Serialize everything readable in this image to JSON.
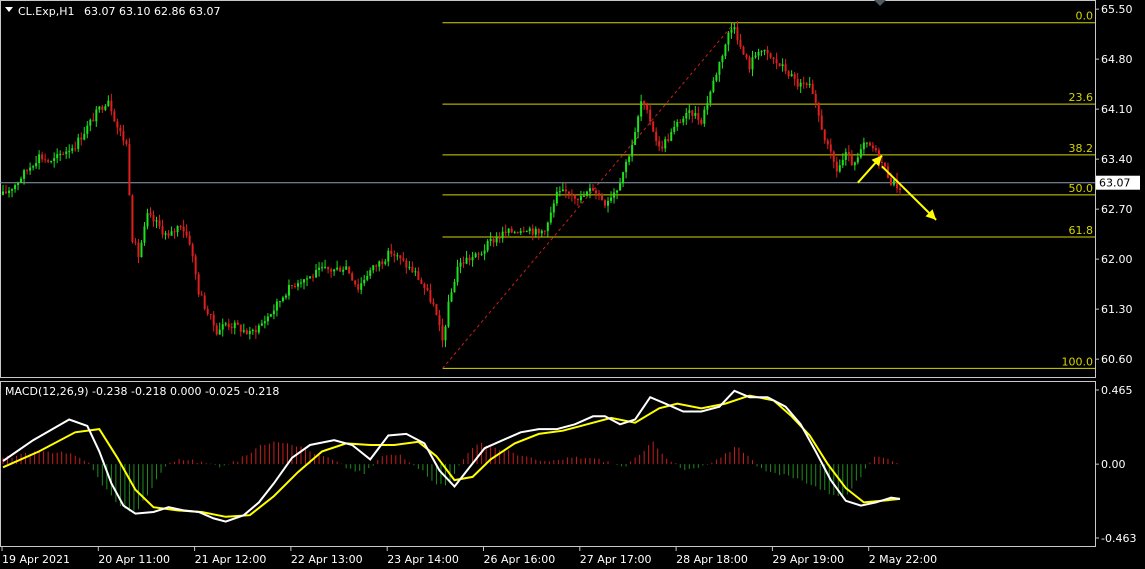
{
  "header": {
    "symbol": "CL.Exp,H1",
    "ohlc": "63.07 63.10 62.86 63.07"
  },
  "macd_header": "MACD(12,26,9) -0.238 -0.218 0.000 -0.025 -0.218",
  "colors": {
    "background": "#000000",
    "bull": "#1ee01e",
    "bear": "#e01e1e",
    "fib": "#d4d400",
    "arrow": "#ffff00",
    "macd_line": "#ffffff",
    "signal_line": "#ffff00",
    "hist_pos": "#c81e1e",
    "hist_neg": "#1e8c1e",
    "current_price_line": "#8aa0b4"
  },
  "chart_data": {
    "type": "candlestick",
    "price_axis": {
      "range": [
        60.35,
        65.6
      ],
      "ticks": [
        "65.50",
        "64.80",
        "64.10",
        "63.40",
        "62.70",
        "62.00",
        "61.30",
        "60.60"
      ],
      "current_price": "63.07"
    },
    "time_axis": {
      "labels": [
        "19 Apr 2021",
        "20 Apr 11:00",
        "21 Apr 12:00",
        "22 Apr 13:00",
        "23 Apr 14:00",
        "26 Apr 16:00",
        "27 Apr 17:00",
        "28 Apr 18:00",
        "29 Apr 19:00",
        "2 May 22:00"
      ]
    },
    "close_path": [
      [
        0,
        62.9
      ],
      [
        4,
        63.05
      ],
      [
        8,
        63.25
      ],
      [
        12,
        63.45
      ],
      [
        16,
        63.35
      ],
      [
        20,
        63.5
      ],
      [
        24,
        63.6
      ],
      [
        28,
        63.85
      ],
      [
        32,
        64.1
      ],
      [
        35,
        64.25
      ],
      [
        38,
        63.85
      ],
      [
        41,
        63.6
      ],
      [
        43,
        62.3
      ],
      [
        45,
        62.05
      ],
      [
        48,
        62.6
      ],
      [
        51,
        62.5
      ],
      [
        55,
        62.3
      ],
      [
        59,
        62.5
      ],
      [
        62,
        62.25
      ],
      [
        65,
        61.55
      ],
      [
        68,
        61.25
      ],
      [
        71,
        61.0
      ],
      [
        74,
        61.1
      ],
      [
        78,
        61.05
      ],
      [
        82,
        60.95
      ],
      [
        86,
        61.1
      ],
      [
        90,
        61.3
      ],
      [
        94,
        61.55
      ],
      [
        98,
        61.7
      ],
      [
        102,
        61.75
      ],
      [
        106,
        61.85
      ],
      [
        110,
        61.85
      ],
      [
        114,
        61.9
      ],
      [
        118,
        61.6
      ],
      [
        121,
        61.8
      ],
      [
        125,
        61.95
      ],
      [
        129,
        62.1
      ],
      [
        133,
        61.95
      ],
      [
        137,
        61.8
      ],
      [
        140,
        61.6
      ],
      [
        143,
        61.35
      ],
      [
        146,
        60.85
      ],
      [
        148,
        61.35
      ],
      [
        151,
        61.9
      ],
      [
        154,
        62.0
      ],
      [
        158,
        62.05
      ],
      [
        162,
        62.25
      ],
      [
        166,
        62.35
      ],
      [
        170,
        62.4
      ],
      [
        174,
        62.45
      ],
      [
        178,
        62.35
      ],
      [
        181,
        62.5
      ],
      [
        184,
        62.9
      ],
      [
        188,
        62.95
      ],
      [
        192,
        62.85
      ],
      [
        196,
        63.0
      ],
      [
        200,
        62.8
      ],
      [
        204,
        63.0
      ],
      [
        207,
        63.35
      ],
      [
        210,
        63.75
      ],
      [
        212,
        64.2
      ],
      [
        215,
        63.95
      ],
      [
        218,
        63.55
      ],
      [
        221,
        63.7
      ],
      [
        225,
        63.95
      ],
      [
        229,
        64.05
      ],
      [
        232,
        63.95
      ],
      [
        235,
        64.35
      ],
      [
        238,
        64.75
      ],
      [
        241,
        65.15
      ],
      [
        243,
        65.3
      ],
      [
        245,
        64.95
      ],
      [
        248,
        64.7
      ],
      [
        251,
        64.95
      ],
      [
        254,
        64.85
      ],
      [
        257,
        64.75
      ],
      [
        260,
        64.65
      ],
      [
        264,
        64.45
      ],
      [
        268,
        64.4
      ],
      [
        271,
        64.0
      ],
      [
        274,
        63.55
      ],
      [
        277,
        63.25
      ],
      [
        280,
        63.45
      ],
      [
        283,
        63.3
      ],
      [
        286,
        63.6
      ],
      [
        289,
        63.55
      ],
      [
        292,
        63.35
      ],
      [
        295,
        63.1
      ],
      [
        298,
        63.0
      ]
    ],
    "x_range": [
      0,
      298
    ],
    "macd": {
      "range": [
        -0.463,
        0.465
      ],
      "ticks": [
        "0.465",
        "0.00",
        "-0.463"
      ],
      "main_path": [
        [
          0,
          0.02
        ],
        [
          10,
          0.15
        ],
        [
          22,
          0.28
        ],
        [
          28,
          0.24
        ],
        [
          32,
          0.08
        ],
        [
          36,
          -0.12
        ],
        [
          40,
          -0.26
        ],
        [
          44,
          -0.31
        ],
        [
          50,
          -0.3
        ],
        [
          55,
          -0.27
        ],
        [
          60,
          -0.29
        ],
        [
          65,
          -0.3
        ],
        [
          70,
          -0.34
        ],
        [
          74,
          -0.36
        ],
        [
          80,
          -0.32
        ],
        [
          85,
          -0.24
        ],
        [
          90,
          -0.12
        ],
        [
          96,
          0.04
        ],
        [
          102,
          0.12
        ],
        [
          110,
          0.15
        ],
        [
          116,
          0.12
        ],
        [
          122,
          0.03
        ],
        [
          128,
          0.18
        ],
        [
          134,
          0.19
        ],
        [
          140,
          0.13
        ],
        [
          145,
          -0.04
        ],
        [
          150,
          -0.14
        ],
        [
          155,
          -0.02
        ],
        [
          160,
          0.1
        ],
        [
          166,
          0.15
        ],
        [
          172,
          0.2
        ],
        [
          178,
          0.22
        ],
        [
          184,
          0.22
        ],
        [
          190,
          0.25
        ],
        [
          196,
          0.3
        ],
        [
          200,
          0.3
        ],
        [
          205,
          0.25
        ],
        [
          210,
          0.28
        ],
        [
          215,
          0.42
        ],
        [
          220,
          0.38
        ],
        [
          226,
          0.33
        ],
        [
          232,
          0.33
        ],
        [
          238,
          0.36
        ],
        [
          243,
          0.46
        ],
        [
          248,
          0.42
        ],
        [
          254,
          0.42
        ],
        [
          260,
          0.36
        ],
        [
          265,
          0.25
        ],
        [
          270,
          0.08
        ],
        [
          275,
          -0.1
        ],
        [
          280,
          -0.23
        ],
        [
          285,
          -0.26
        ],
        [
          290,
          -0.24
        ],
        [
          295,
          -0.21
        ],
        [
          298,
          -0.218
        ]
      ],
      "signal_path": [
        [
          0,
          -0.02
        ],
        [
          12,
          0.08
        ],
        [
          24,
          0.2
        ],
        [
          32,
          0.22
        ],
        [
          38,
          0.04
        ],
        [
          44,
          -0.16
        ],
        [
          50,
          -0.27
        ],
        [
          58,
          -0.29
        ],
        [
          66,
          -0.3
        ],
        [
          74,
          -0.33
        ],
        [
          82,
          -0.32
        ],
        [
          90,
          -0.2
        ],
        [
          98,
          -0.05
        ],
        [
          106,
          0.08
        ],
        [
          114,
          0.13
        ],
        [
          122,
          0.12
        ],
        [
          130,
          0.12
        ],
        [
          138,
          0.14
        ],
        [
          144,
          0.05
        ],
        [
          150,
          -0.1
        ],
        [
          156,
          -0.08
        ],
        [
          162,
          0.03
        ],
        [
          170,
          0.13
        ],
        [
          178,
          0.19
        ],
        [
          186,
          0.21
        ],
        [
          194,
          0.25
        ],
        [
          202,
          0.29
        ],
        [
          210,
          0.26
        ],
        [
          218,
          0.35
        ],
        [
          224,
          0.38
        ],
        [
          232,
          0.35
        ],
        [
          240,
          0.38
        ],
        [
          248,
          0.43
        ],
        [
          256,
          0.4
        ],
        [
          262,
          0.3
        ],
        [
          268,
          0.18
        ],
        [
          274,
          0.0
        ],
        [
          280,
          -0.15
        ],
        [
          286,
          -0.24
        ],
        [
          292,
          -0.23
        ],
        [
          298,
          -0.218
        ]
      ],
      "hist_path": [
        [
          0,
          0.04
        ],
        [
          10,
          0.07
        ],
        [
          20,
          0.08
        ],
        [
          28,
          0.02
        ],
        [
          32,
          -0.1
        ],
        [
          36,
          -0.2
        ],
        [
          40,
          -0.28
        ],
        [
          44,
          -0.3
        ],
        [
          48,
          -0.2
        ],
        [
          52,
          -0.06
        ],
        [
          56,
          0.02
        ],
        [
          60,
          0.03
        ],
        [
          66,
          0.01
        ],
        [
          72,
          -0.01
        ],
        [
          78,
          0.02
        ],
        [
          84,
          0.1
        ],
        [
          90,
          0.15
        ],
        [
          96,
          0.13
        ],
        [
          102,
          0.08
        ],
        [
          108,
          0.04
        ],
        [
          114,
          -0.02
        ],
        [
          120,
          -0.06
        ],
        [
          126,
          0.05
        ],
        [
          132,
          0.06
        ],
        [
          138,
          -0.02
        ],
        [
          144,
          -0.12
        ],
        [
          148,
          -0.14
        ],
        [
          152,
          0.02
        ],
        [
          158,
          0.13
        ],
        [
          164,
          0.1
        ],
        [
          170,
          0.07
        ],
        [
          176,
          0.03
        ],
        [
          182,
          0.01
        ],
        [
          188,
          0.04
        ],
        [
          194,
          0.04
        ],
        [
          200,
          0.02
        ],
        [
          206,
          -0.02
        ],
        [
          212,
          0.06
        ],
        [
          216,
          0.14
        ],
        [
          220,
          0.05
        ],
        [
          226,
          -0.04
        ],
        [
          232,
          -0.02
        ],
        [
          238,
          0.03
        ],
        [
          244,
          0.12
        ],
        [
          250,
          0.0
        ],
        [
          256,
          -0.06
        ],
        [
          262,
          -0.08
        ],
        [
          268,
          -0.12
        ],
        [
          274,
          -0.18
        ],
        [
          280,
          -0.2
        ],
        [
          286,
          -0.05
        ],
        [
          290,
          0.05
        ],
        [
          294,
          0.04
        ],
        [
          298,
          0.0
        ]
      ]
    },
    "fibonacci": {
      "levels": [
        {
          "label": "0.0",
          "price": 65.31
        },
        {
          "label": "23.6",
          "price": 64.17
        },
        {
          "label": "38.2",
          "price": 63.46
        },
        {
          "label": "50.0",
          "price": 62.9
        },
        {
          "label": "61.8",
          "price": 62.31
        },
        {
          "label": "100.0",
          "price": 60.47
        }
      ],
      "start_x": 146,
      "end_x": 243
    },
    "arrows": [
      {
        "from": [
          284,
          63.07
        ],
        "to": [
          292,
          63.45
        ]
      },
      {
        "from": [
          292,
          63.3
        ],
        "to": [
          310,
          62.55
        ]
      }
    ]
  }
}
